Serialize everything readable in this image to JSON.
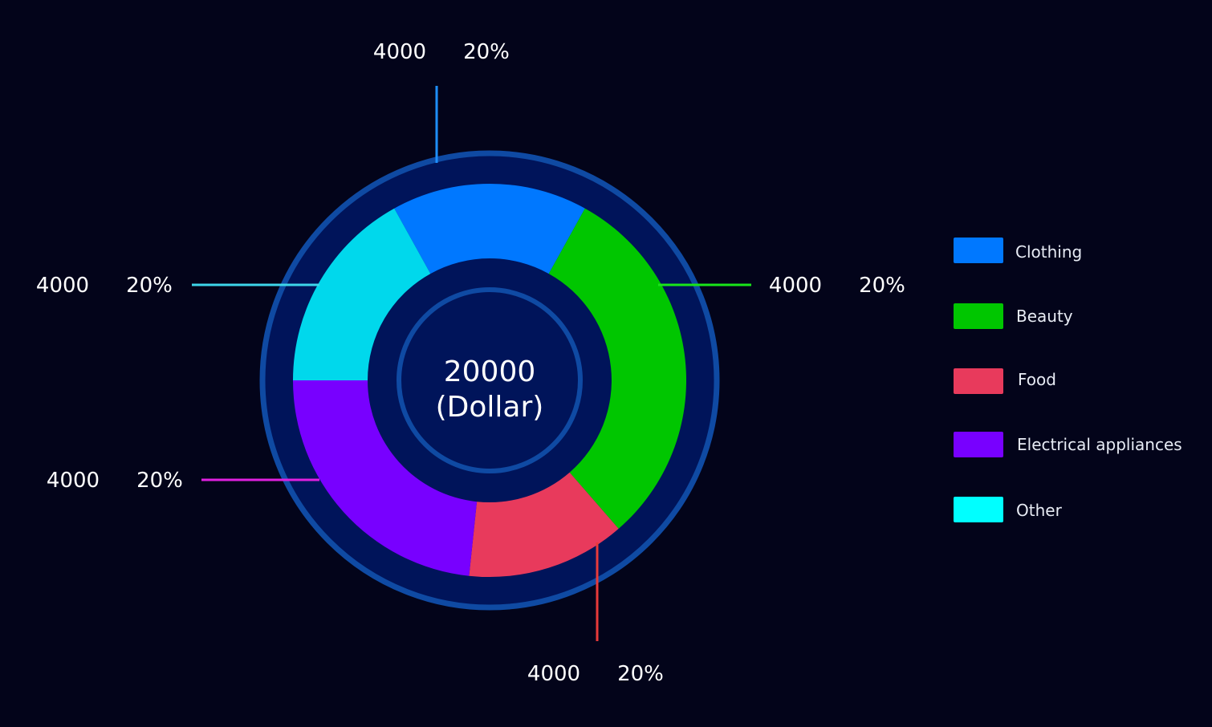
{
  "chart_data": {
    "type": "pie",
    "style": "donut",
    "total": {
      "value": "20000",
      "unit": "(Dollar)"
    },
    "slices": [
      {
        "name": "Clothing",
        "value": 4000,
        "percent_label": "20%",
        "value_label": "4000",
        "color": "#0078ff",
        "start_deg": -29,
        "end_deg": 29
      },
      {
        "name": "Beauty",
        "value": 4000,
        "percent_label": "20%",
        "value_label": "4000",
        "color": "#00c600",
        "start_deg": 29,
        "end_deg": 139
      },
      {
        "name": "Food",
        "value": 4000,
        "percent_label": "20%",
        "value_label": "4000",
        "color": "#e83a5c",
        "start_deg": 139,
        "end_deg": 186
      },
      {
        "name": "Electrical appliances",
        "value": 4000,
        "percent_label": "20%",
        "value_label": "4000",
        "color": "#7800ff",
        "start_deg": 186,
        "end_deg": 270
      },
      {
        "name": "Other",
        "value": 4000,
        "percent_label": "20%",
        "value_label": "4000",
        "color": "#00d8ec",
        "start_deg": 270,
        "end_deg": 331
      }
    ],
    "leaders": [
      {
        "slice": "Clothing",
        "color": "#1e8fff"
      },
      {
        "slice": "Beauty",
        "color": "#19e619"
      },
      {
        "slice": "Food",
        "color": "#e83a3a"
      },
      {
        "slice": "Electrical appliances",
        "color": "#e020e0"
      },
      {
        "slice": "Other",
        "color": "#3ed6ea"
      }
    ],
    "legend": {
      "placement": "right",
      "items": [
        {
          "label": "Clothing",
          "color": "#0078ff"
        },
        {
          "label": "Beauty",
          "color": "#00c600"
        },
        {
          "label": "Food",
          "color": "#e83a5c"
        },
        {
          "label": "Electrical appliances",
          "color": "#7800ff"
        },
        {
          "label": "Other",
          "color": "#00ffff"
        }
      ]
    },
    "theme": {
      "background": "#03041a",
      "ring_fill": "#00145a",
      "ring_stroke": "#0f4aa3"
    }
  }
}
